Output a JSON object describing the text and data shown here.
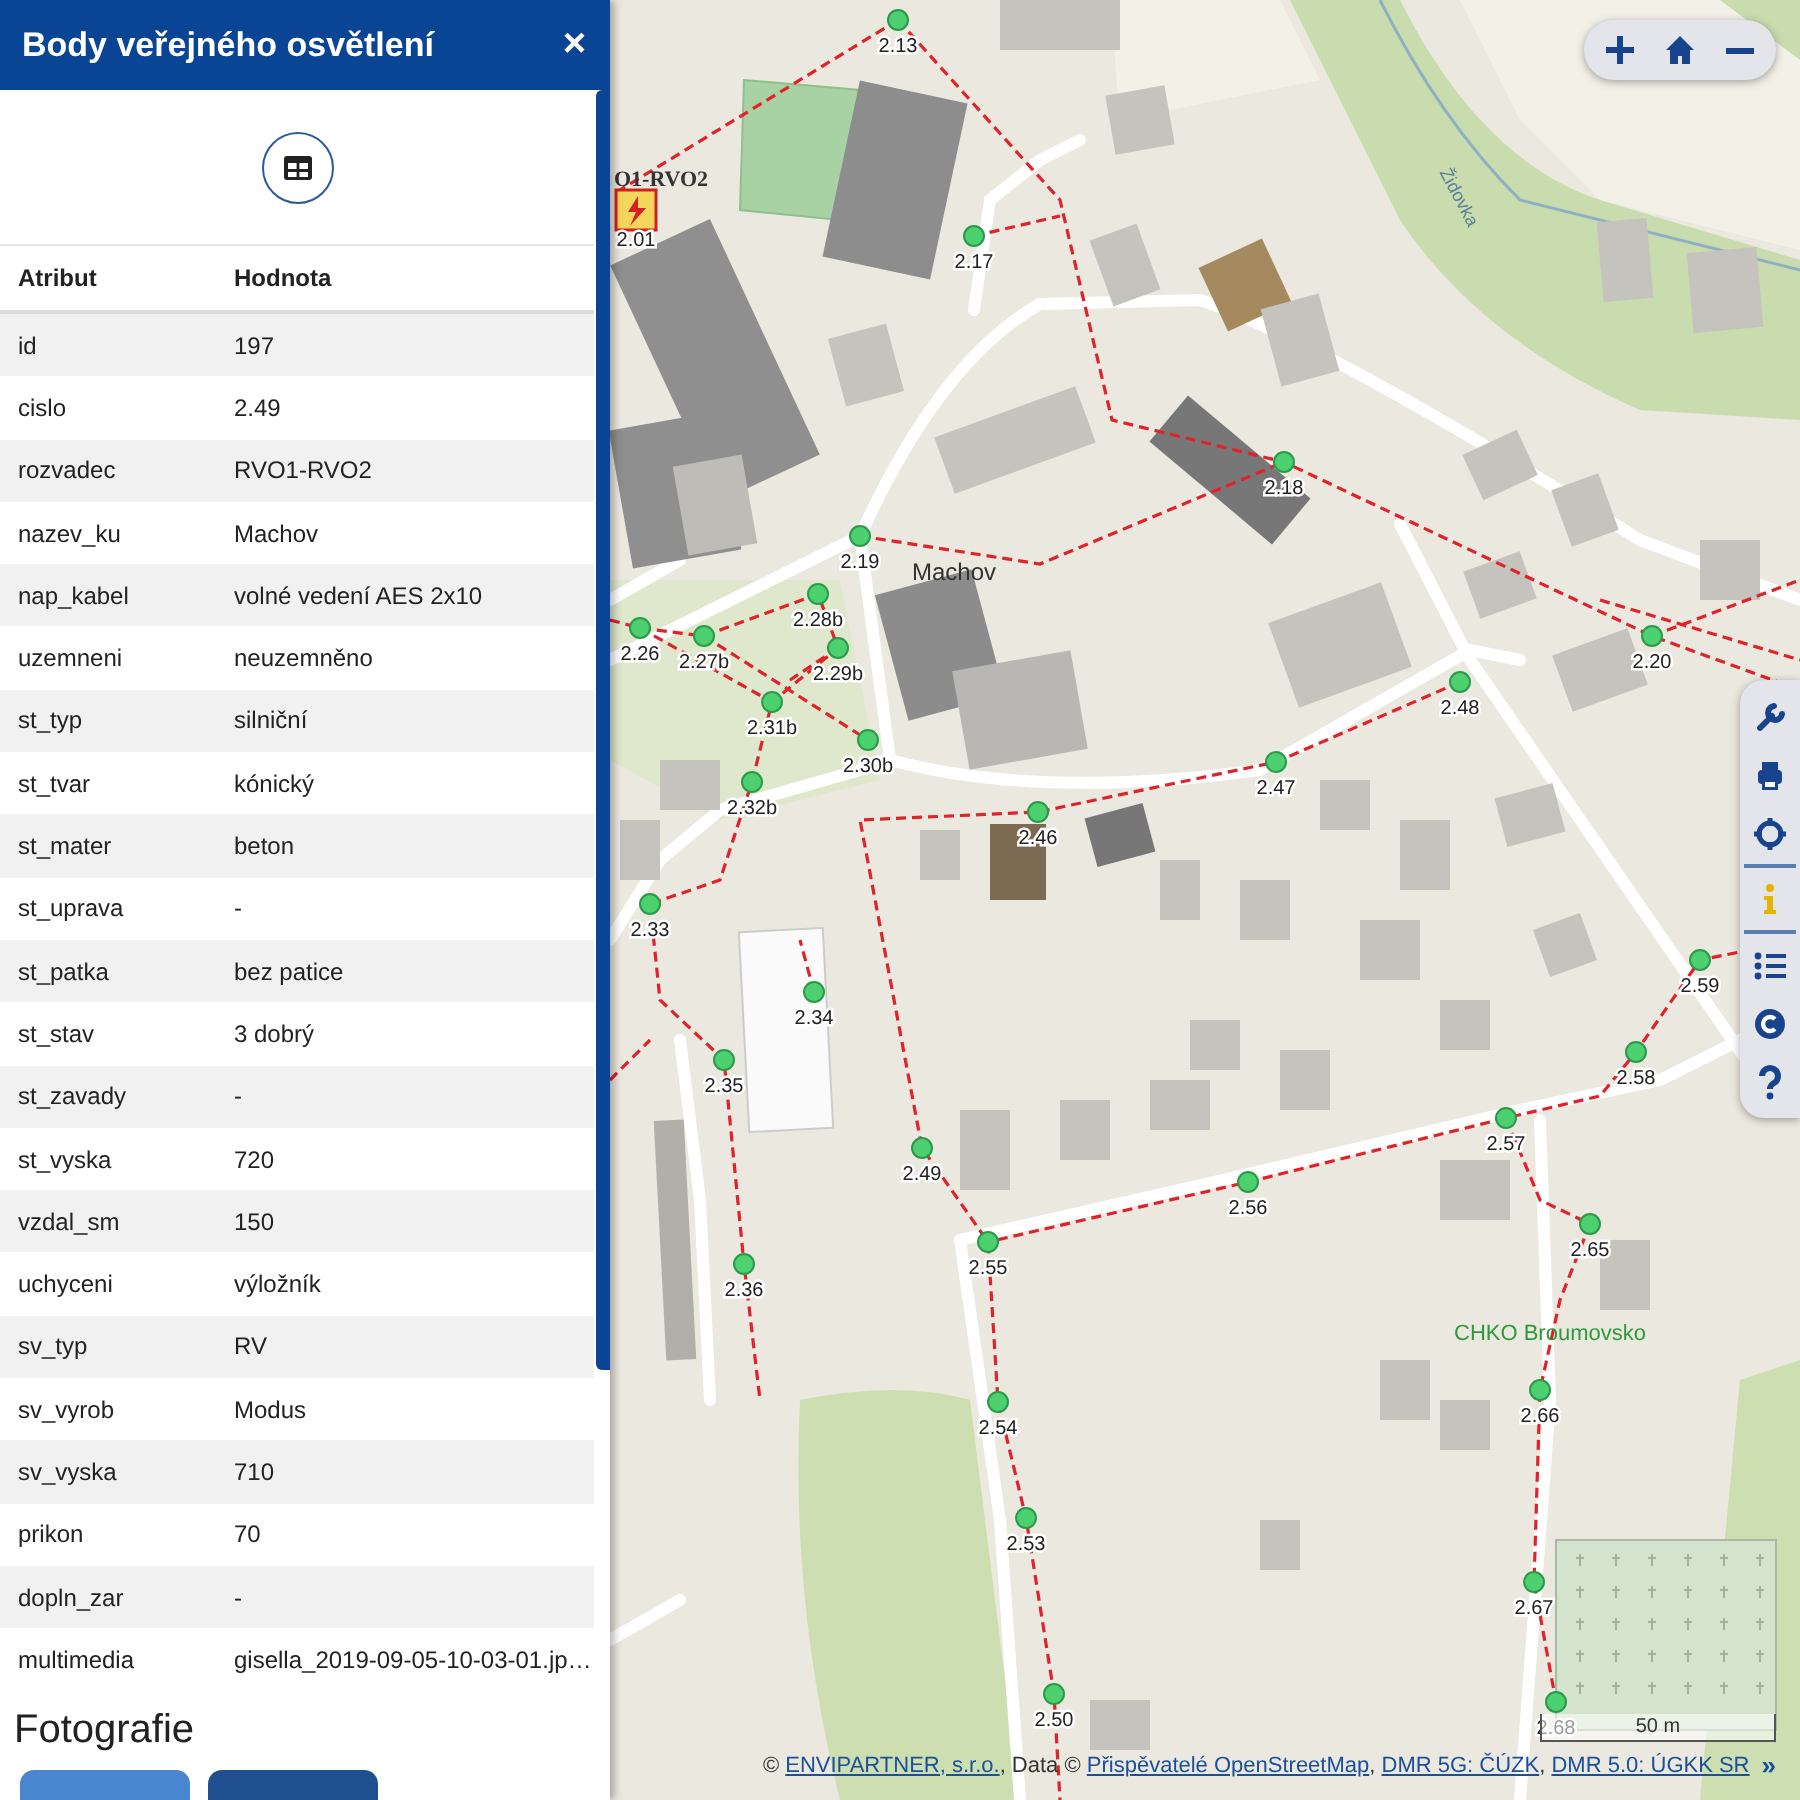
{
  "panel": {
    "title": "Body veřejného osvětlení",
    "close": "×",
    "table": {
      "columns": [
        "Atribut",
        "Hodnota"
      ],
      "rows": [
        {
          "attribute": "id",
          "value": "197"
        },
        {
          "attribute": "cislo",
          "value": "2.49"
        },
        {
          "attribute": "rozvadec",
          "value": "RVO1-RVO2"
        },
        {
          "attribute": "nazev_ku",
          "value": "Machov"
        },
        {
          "attribute": "nap_kabel",
          "value": "volné vedení AES 2x10"
        },
        {
          "attribute": "uzemneni",
          "value": "neuzemněno"
        },
        {
          "attribute": "st_typ",
          "value": "silniční"
        },
        {
          "attribute": "st_tvar",
          "value": "kónický"
        },
        {
          "attribute": "st_mater",
          "value": "beton"
        },
        {
          "attribute": "st_uprava",
          "value": "-"
        },
        {
          "attribute": "st_patka",
          "value": "bez patice"
        },
        {
          "attribute": "st_stav",
          "value": "3 dobrý"
        },
        {
          "attribute": "st_zavady",
          "value": "-"
        },
        {
          "attribute": "st_vyska",
          "value": "720"
        },
        {
          "attribute": "vzdal_sm",
          "value": "150"
        },
        {
          "attribute": "uchyceni",
          "value": "výložník"
        },
        {
          "attribute": "sv_typ",
          "value": "RV"
        },
        {
          "attribute": "sv_vyrob",
          "value": "Modus"
        },
        {
          "attribute": "sv_vyska",
          "value": "710"
        },
        {
          "attribute": "prikon",
          "value": "70"
        },
        {
          "attribute": "dopln_zar",
          "value": "-"
        },
        {
          "attribute": "multimedia",
          "value": "gisella_2019-09-05-10-03-01.jp…"
        }
      ]
    },
    "photos_heading": "Fotografie"
  },
  "map": {
    "switchboard_label": "O1-RVO2",
    "points": [
      "2.13",
      "2.01",
      "2.17",
      "2.18",
      "2.19",
      "2.20",
      "2.26",
      "2.27b",
      "2.28b",
      "2.29b",
      "2.31b",
      "2.30b",
      "2.32b",
      "2.48",
      "2.47",
      "2.46",
      "2.33",
      "2.34",
      "2.35",
      "2.59",
      "2.58",
      "2.57",
      "2.56",
      "2.49",
      "2.55",
      "2.65",
      "2.36",
      "2.66",
      "2.54",
      "2.53",
      "2.67",
      "2.50",
      "2.68"
    ],
    "place_labels": [
      {
        "kind": "village",
        "text": "Machov"
      },
      {
        "kind": "stream",
        "text": "Židovka"
      },
      {
        "kind": "protected-area",
        "text": "CHKO Broumovsko"
      }
    ],
    "scale": "50 m",
    "tools": [
      {
        "selected": false
      },
      {
        "selected": false
      },
      {
        "selected": false
      },
      {
        "selected": true
      },
      {
        "selected": false
      },
      {
        "selected": false
      },
      {
        "selected": false
      }
    ],
    "attribution": [
      {
        "kind": "text",
        "text": "© "
      },
      {
        "kind": "link",
        "text": "ENVIPARTNER, s.r.o."
      },
      {
        "kind": "text",
        "text": ", Data © "
      },
      {
        "kind": "link",
        "text": "Přispěvatelé OpenStreetMap"
      },
      {
        "kind": "text",
        "text": ", "
      },
      {
        "kind": "link",
        "text": "DMR 5G: ČÚZK"
      },
      {
        "kind": "text",
        "text": ", "
      },
      {
        "kind": "link",
        "text": "DMR 5.0: ÚGKK SR"
      }
    ],
    "attribution_toggle": "»"
  }
}
